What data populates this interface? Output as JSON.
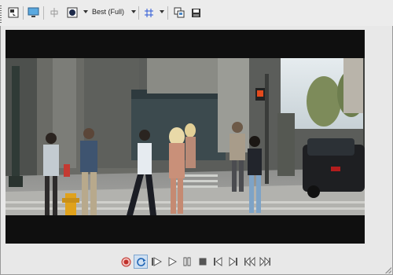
{
  "toolbar": {
    "quality_select": {
      "value": "Best (Full)"
    }
  },
  "icons": {
    "properties": "properties-icon",
    "monitor": "external-monitor-icon",
    "split": "split-screen-icon",
    "channels": "overlay-channel-icon",
    "grid": "grid-overlay-icon",
    "copy": "copy-snapshot-icon",
    "save": "save-snapshot-icon",
    "record": "record-icon",
    "loop": "loop-icon",
    "play_from_start": "play-from-start-icon",
    "play": "play-icon",
    "pause": "pause-icon",
    "stop": "stop-icon",
    "prev": "previous-frame-icon",
    "next": "next-frame-icon",
    "rewind": "rewind-icon",
    "fast_forward": "fast-forward-icon"
  },
  "colors": {
    "record": "#c0302a",
    "loop_active": "#1e64b4",
    "grid": "#2a56d6",
    "letterbox": "#0f0f0f",
    "window_bg": "#e8e8e8"
  }
}
